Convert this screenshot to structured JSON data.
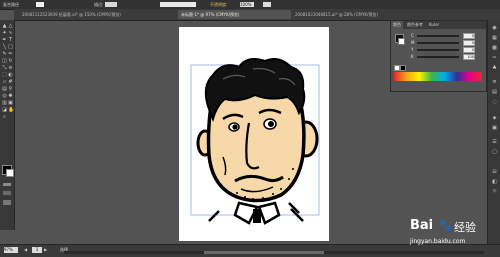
{
  "control_bar": {
    "label": "复合路径",
    "stroke_label": "描边:",
    "style_label": "不透明度:",
    "opacity": "100%"
  },
  "tabs": [
    {
      "label": "20081112523939 拓展版.ai* @ 150% (CMYK/预览)",
      "active": false
    },
    {
      "label": "未标题-1* @ 97% (CMYK/预览)",
      "active": true
    },
    {
      "label": "20081031046815.ai* @ 28% (CMYK/预览)",
      "active": false
    }
  ],
  "color_panel": {
    "tabs": [
      "颜色",
      "颜色参考",
      "Kuler"
    ],
    "channels": [
      {
        "label": "C",
        "value": "0"
      },
      {
        "label": "M",
        "value": "0"
      },
      {
        "label": "Y",
        "value": "0"
      },
      {
        "label": "K",
        "value": "100"
      }
    ]
  },
  "status": {
    "zoom": "97%",
    "page": "1",
    "mode": "选择"
  },
  "watermark": {
    "brand": "Bai",
    "brand2": "经验",
    "url": "jingyan.baidu.com"
  }
}
